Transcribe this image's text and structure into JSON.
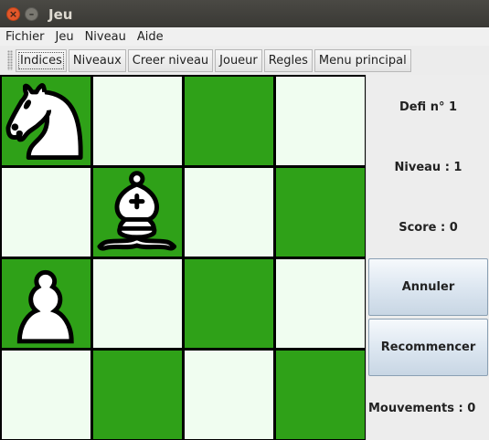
{
  "window": {
    "title": "Jeu",
    "close_glyph": "×",
    "min_glyph": "–"
  },
  "menubar": {
    "items": [
      "Fichier",
      "Jeu",
      "Niveau",
      "Aide"
    ]
  },
  "toolbar": {
    "buttons": [
      "Indices",
      "Niveaux",
      "Creer niveau",
      "Joueur",
      "Regles",
      "Menu principal"
    ]
  },
  "board": {
    "size": 4,
    "colors": {
      "light": "#f0fdf0",
      "dark": "#2fa118"
    },
    "pieces": [
      {
        "row": 0,
        "col": 0,
        "piece": "knight",
        "color": "white"
      },
      {
        "row": 1,
        "col": 1,
        "piece": "bishop",
        "color": "white"
      },
      {
        "row": 2,
        "col": 0,
        "piece": "pawn",
        "color": "white"
      }
    ]
  },
  "sidebar": {
    "defi": "Defi n° 1",
    "niveau": "Niveau : 1",
    "score": "Score : 0",
    "annuler": "Annuler",
    "recommencer": "Recommencer",
    "mouvements": "Mouvements : 0"
  }
}
